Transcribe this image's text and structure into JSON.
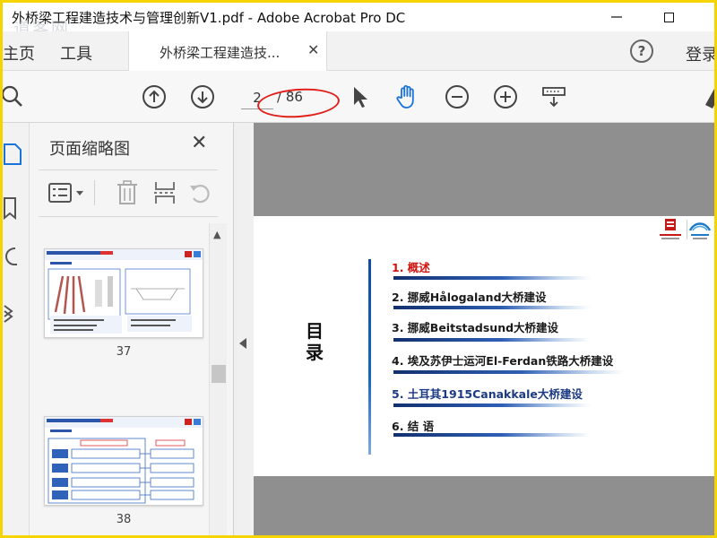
{
  "window": {
    "title": "外桥梁工程建造技术与管理创新V1.pdf - Adobe Acrobat Pro DC",
    "watermark": "道客网"
  },
  "tabs": {
    "home": "主页",
    "tools": "工具",
    "doc_tab": "外桥梁工程建造技...",
    "help": "?",
    "login": "登录"
  },
  "toolbar": {
    "current_page": "2",
    "total_pages": "/ 86"
  },
  "thumbnail_panel": {
    "title": "页面缩略图",
    "thumbnails": [
      {
        "page_label": "37"
      },
      {
        "page_label": "38"
      }
    ]
  },
  "document": {
    "mulu": "目录",
    "toc": [
      {
        "label": "1. 概述"
      },
      {
        "label": "2. 挪威Hålogaland大桥建设"
      },
      {
        "label": "3. 挪威Beitstadsund大桥建设"
      },
      {
        "label": "4. 埃及苏伊士运河El-Ferdan铁路大桥建设"
      },
      {
        "label": "5. 土耳其1915Canakkale大桥建设"
      },
      {
        "label": "6. 结 语"
      }
    ]
  },
  "colors": {
    "accent_blue": "#1565c0",
    "toc_active_red": "#d2140f",
    "annotation_red": "#e0201b",
    "border_yellow": "#f5d400"
  }
}
